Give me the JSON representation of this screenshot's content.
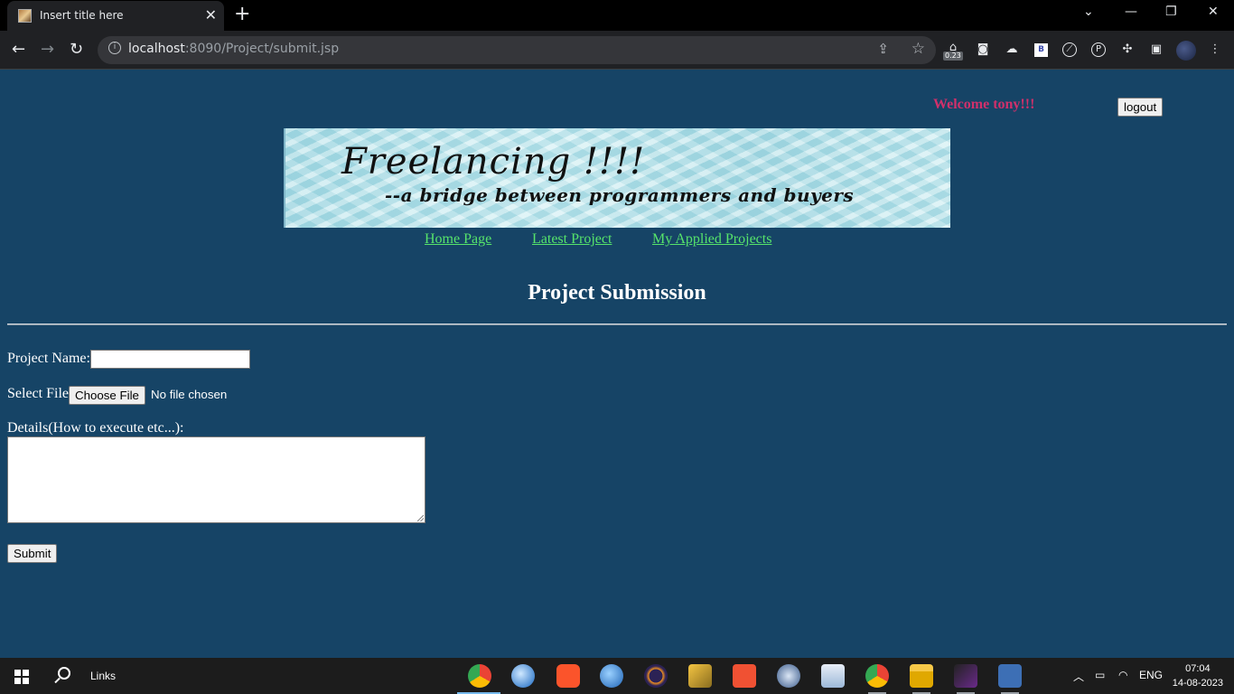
{
  "browser": {
    "tab_title": "Insert title here",
    "url_host": "localhost",
    "url_rest": ":8090/Project/submit.jsp",
    "extension_badge": "0.23"
  },
  "header": {
    "welcome": "Welcome tony!!!",
    "logout_label": "logout"
  },
  "banner": {
    "title": "Freelancing !!!!",
    "tagline": "--a bridge between programmers and buyers"
  },
  "nav": {
    "links": [
      "Home Page",
      "Latest Project",
      "My Applied Projects"
    ]
  },
  "form": {
    "heading": "Project Submission",
    "project_name_label": "Project Name:",
    "project_name_value": "",
    "select_file_label": "Select File",
    "choose_file_label": "Choose File",
    "no_file_text": "No file chosen",
    "details_label": "Details(How to execute etc...):",
    "details_value": "",
    "submit_label": "Submit"
  },
  "taskbar": {
    "search_label": "Links",
    "language": "ENG",
    "time": "07:04",
    "date": "14-08-2023"
  },
  "colors": {
    "page_background": "#164466",
    "welcome_text": "#d1306b",
    "nav_link": "#56e46b"
  }
}
